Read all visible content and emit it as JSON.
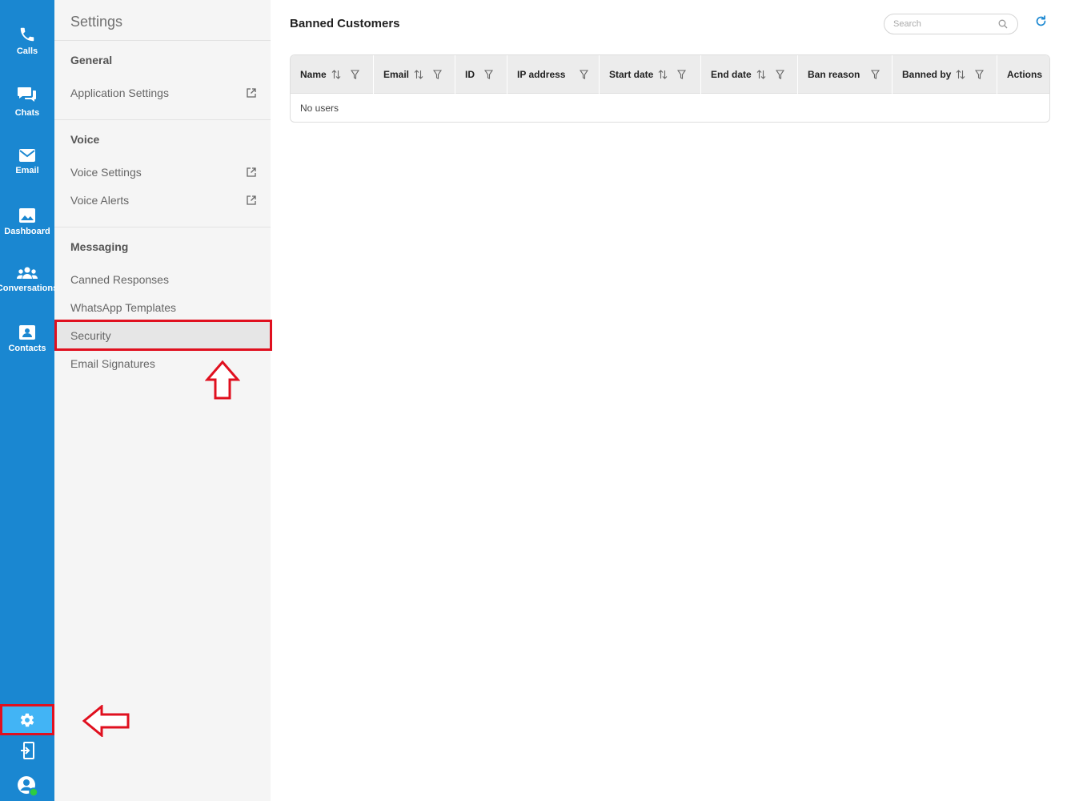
{
  "rail": {
    "items": [
      {
        "label": "Calls",
        "icon": "phone-icon"
      },
      {
        "label": "Chats",
        "icon": "chat-bubbles-icon"
      },
      {
        "label": "Email",
        "icon": "envelope-icon"
      },
      {
        "label": "Dashboard",
        "icon": "image-chart-icon"
      },
      {
        "label": "Conversations",
        "icon": "people-group-icon"
      },
      {
        "label": "Contacts",
        "icon": "contact-card-icon"
      }
    ],
    "bottom_icons": [
      "gear-icon",
      "logout-icon",
      "user-status-icon"
    ],
    "active": "settings",
    "status": "online"
  },
  "settings": {
    "title": "Settings",
    "sections": [
      {
        "heading": "General",
        "items": [
          {
            "label": "Application Settings",
            "external": true
          }
        ]
      },
      {
        "heading": "Voice",
        "items": [
          {
            "label": "Voice Settings",
            "external": true
          },
          {
            "label": "Voice Alerts",
            "external": true
          }
        ]
      },
      {
        "heading": "Messaging",
        "items": [
          {
            "label": "Canned Responses",
            "external": false
          },
          {
            "label": "WhatsApp Templates",
            "external": false
          },
          {
            "label": "Security",
            "external": false,
            "selected": true
          },
          {
            "label": "Email Signatures",
            "external": false
          }
        ]
      }
    ]
  },
  "main": {
    "title": "Banned Customers",
    "search": {
      "placeholder": "Search",
      "value": ""
    },
    "table": {
      "columns": [
        {
          "label": "Name",
          "sortable": true,
          "filterable": true
        },
        {
          "label": "Email",
          "sortable": true,
          "filterable": true
        },
        {
          "label": "ID",
          "sortable": false,
          "filterable": true
        },
        {
          "label": "IP address",
          "sortable": false,
          "filterable": true
        },
        {
          "label": "Start date",
          "sortable": true,
          "filterable": true
        },
        {
          "label": "End date",
          "sortable": true,
          "filterable": true
        },
        {
          "label": "Ban reason",
          "sortable": false,
          "filterable": true
        },
        {
          "label": "Banned by",
          "sortable": true,
          "filterable": true
        },
        {
          "label": "Actions",
          "sortable": false,
          "filterable": false
        }
      ],
      "rows": [],
      "empty_message": "No users"
    }
  },
  "colors": {
    "rail": "#1a87d1",
    "rail_active": "#42b4f5",
    "annotation": "#e0101f",
    "panel": "#f5f5f5",
    "accent": "#1a87d1",
    "online": "#2ecc40"
  }
}
